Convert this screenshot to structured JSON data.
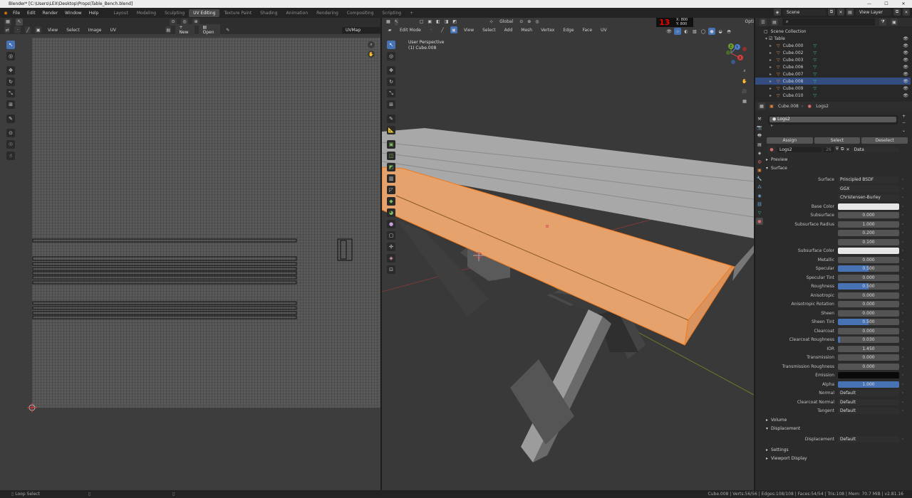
{
  "window": {
    "title": "Blender* [C:\\Users\\LEX\\Desktop\\Props\\Table_Bench.blend]",
    "controls": [
      "—",
      "☐",
      "✕"
    ]
  },
  "topbar": {
    "menus": [
      "File",
      "Edit",
      "Render",
      "Window",
      "Help"
    ],
    "workspaces": [
      "Layout",
      "Modeling",
      "Sculpting",
      "UV Editing",
      "Texture Paint",
      "Shading",
      "Animation",
      "Rendering",
      "Compositing",
      "Scripting",
      "+"
    ],
    "active_workspace": "UV Editing",
    "scene": "Scene",
    "view_layer": "View Layer"
  },
  "uv_editor": {
    "menus": [
      "View",
      "Select",
      "Image",
      "UV"
    ],
    "new_label": "New",
    "open_label": "Open",
    "uvmap": "UVMap"
  },
  "viewport": {
    "mode": "Edit Mode",
    "menus": [
      "View",
      "Select",
      "Add",
      "Mesh",
      "Vertex",
      "Edge",
      "Face",
      "UV"
    ],
    "orientation": "Global",
    "options": "Options",
    "overlay_title": "User Perspective",
    "overlay_object": "(1) Cube.008",
    "fps_readout": "13",
    "coord_x": "X: 800",
    "coord_y": "Y: 800",
    "gizmo_axes": [
      "Z",
      "Y",
      "X"
    ]
  },
  "outliner": {
    "root": "Scene Collection",
    "collection": "Table",
    "items": [
      {
        "name": "Cube.000",
        "selected": false
      },
      {
        "name": "Cube.002",
        "selected": false
      },
      {
        "name": "Cube.003",
        "selected": false
      },
      {
        "name": "Cube.006",
        "selected": false
      },
      {
        "name": "Cube.007",
        "selected": false
      },
      {
        "name": "Cube.008",
        "selected": true
      },
      {
        "name": "Cube.009",
        "selected": false
      },
      {
        "name": "Cube.010",
        "selected": false
      }
    ]
  },
  "properties": {
    "object": "Cube.008",
    "material": "Logs2",
    "slot": "Logs2",
    "assign": "Assign",
    "select": "Select",
    "deselect": "Deselect",
    "users": "26",
    "data": "Data",
    "preview": "Preview",
    "surface_section": "Surface",
    "rows": [
      {
        "label": "Surface",
        "value": "Principled BSDF",
        "kind": "dd"
      },
      {
        "label": "",
        "value": "GGX",
        "kind": "dd"
      },
      {
        "label": "",
        "value": "Christensen-Burley",
        "kind": "dd"
      },
      {
        "label": "Base Color",
        "value": "",
        "kind": "color",
        "color": "#e6e6e6"
      },
      {
        "label": "Subsurface",
        "value": "0.000",
        "kind": "num"
      },
      {
        "label": "Subsurface Radius",
        "value": "1.000",
        "kind": "num"
      },
      {
        "label": "",
        "value": "0.200",
        "kind": "num"
      },
      {
        "label": "",
        "value": "0.100",
        "kind": "num"
      },
      {
        "label": "Subsurface Color",
        "value": "",
        "kind": "color",
        "color": "#e6e6e6"
      },
      {
        "label": "Metallic",
        "value": "0.000",
        "kind": "num"
      },
      {
        "label": "Specular",
        "value": "0.500",
        "kind": "blue",
        "fill": 0.5
      },
      {
        "label": "Specular Tint",
        "value": "0.000",
        "kind": "num"
      },
      {
        "label": "Roughness",
        "value": "0.500",
        "kind": "blue",
        "fill": 0.5
      },
      {
        "label": "Anisotropic",
        "value": "0.000",
        "kind": "num"
      },
      {
        "label": "Anisotropic Rotation",
        "value": "0.000",
        "kind": "num"
      },
      {
        "label": "Sheen",
        "value": "0.000",
        "kind": "num"
      },
      {
        "label": "Sheen Tint",
        "value": "0.500",
        "kind": "blue",
        "fill": 0.5
      },
      {
        "label": "Clearcoat",
        "value": "0.000",
        "kind": "num"
      },
      {
        "label": "Clearcoat Roughness",
        "value": "0.030",
        "kind": "blue",
        "fill": 0.03
      },
      {
        "label": "IOR",
        "value": "1.450",
        "kind": "num"
      },
      {
        "label": "Transmission",
        "value": "0.000",
        "kind": "num"
      },
      {
        "label": "Transmission Roughness",
        "value": "0.000",
        "kind": "num"
      },
      {
        "label": "Emission",
        "value": "",
        "kind": "color",
        "color": "#0a0a0a"
      },
      {
        "label": "Alpha",
        "value": "1.000",
        "kind": "blue",
        "fill": 1.0
      },
      {
        "label": "Normal",
        "value": "Default",
        "kind": "dd"
      },
      {
        "label": "Clearcoat Normal",
        "value": "Default",
        "kind": "dd"
      },
      {
        "label": "Tangent",
        "value": "Default",
        "kind": "dd"
      }
    ],
    "volume": "Volume",
    "displacement_section": "Displacement",
    "displacement_label": "Displacement",
    "displacement_value": "Default",
    "settings": "Settings",
    "viewport_display": "Viewport Display"
  },
  "status": {
    "left": "Loop Select",
    "right": "Cube.008 | Verts:56/56 | Edges:108/108 | Faces:54/54 | Tris:108 | Mem: 70.7 MiB | v2.81.16"
  },
  "colors": {
    "accent": "#4772b3",
    "selected_face": "#e5a26c",
    "active_row": "#334d80"
  }
}
